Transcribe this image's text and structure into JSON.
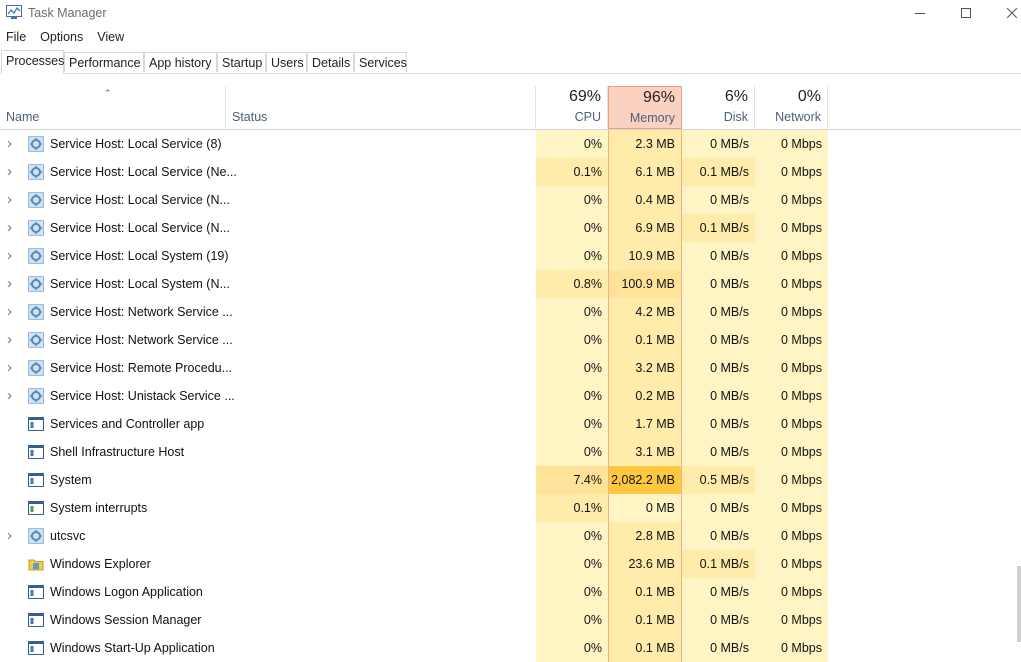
{
  "window": {
    "title": "Task Manager"
  },
  "menu": [
    "File",
    "Options",
    "View"
  ],
  "tabs": [
    "Processes",
    "Performance",
    "App history",
    "Startup",
    "Users",
    "Details",
    "Services"
  ],
  "header": {
    "name": "Name",
    "status": "Status",
    "cpu": {
      "pct": "69%",
      "label": "CPU"
    },
    "memory": {
      "pct": "96%",
      "label": "Memory"
    },
    "disk": {
      "pct": "6%",
      "label": "Disk"
    },
    "network": {
      "pct": "0%",
      "label": "Network"
    }
  },
  "rows": [
    {
      "name": "Service Host: Local Service (8)",
      "cpu": "0%",
      "memory": "2.3 MB",
      "disk": "0 MB/s",
      "network": "0 Mbps",
      "expandable": true,
      "icon": "gear",
      "heat": [
        0,
        1,
        0,
        0
      ]
    },
    {
      "name": "Service Host: Local Service (Ne...",
      "cpu": "0.1%",
      "memory": "6.1 MB",
      "disk": "0.1 MB/s",
      "network": "0 Mbps",
      "expandable": true,
      "icon": "gear",
      "heat": [
        1,
        1,
        1,
        0
      ]
    },
    {
      "name": "Service Host: Local Service (N...",
      "cpu": "0%",
      "memory": "0.4 MB",
      "disk": "0 MB/s",
      "network": "0 Mbps",
      "expandable": true,
      "icon": "gear",
      "heat": [
        0,
        1,
        0,
        0
      ]
    },
    {
      "name": "Service Host: Local Service (N...",
      "cpu": "0%",
      "memory": "6.9 MB",
      "disk": "0.1 MB/s",
      "network": "0 Mbps",
      "expandable": true,
      "icon": "gear",
      "heat": [
        0,
        1,
        1,
        0
      ]
    },
    {
      "name": "Service Host: Local System (19)",
      "cpu": "0%",
      "memory": "10.9 MB",
      "disk": "0 MB/s",
      "network": "0 Mbps",
      "expandable": true,
      "icon": "gear",
      "heat": [
        0,
        1,
        0,
        0
      ]
    },
    {
      "name": "Service Host: Local System (N...",
      "cpu": "0.8%",
      "memory": "100.9 MB",
      "disk": "0 MB/s",
      "network": "0 Mbps",
      "expandable": true,
      "icon": "gear",
      "heat": [
        1,
        2,
        0,
        0
      ]
    },
    {
      "name": "Service Host: Network Service ...",
      "cpu": "0%",
      "memory": "4.2 MB",
      "disk": "0 MB/s",
      "network": "0 Mbps",
      "expandable": true,
      "icon": "gear",
      "heat": [
        0,
        1,
        0,
        0
      ]
    },
    {
      "name": "Service Host: Network Service ...",
      "cpu": "0%",
      "memory": "0.1 MB",
      "disk": "0 MB/s",
      "network": "0 Mbps",
      "expandable": true,
      "icon": "gear",
      "heat": [
        0,
        1,
        0,
        0
      ]
    },
    {
      "name": "Service Host: Remote Procedu...",
      "cpu": "0%",
      "memory": "3.2 MB",
      "disk": "0 MB/s",
      "network": "0 Mbps",
      "expandable": true,
      "icon": "gear",
      "heat": [
        0,
        1,
        0,
        0
      ]
    },
    {
      "name": "Service Host: Unistack Service ...",
      "cpu": "0%",
      "memory": "0.2 MB",
      "disk": "0 MB/s",
      "network": "0 Mbps",
      "expandable": true,
      "icon": "gear",
      "heat": [
        0,
        1,
        0,
        0
      ]
    },
    {
      "name": "Services and Controller app",
      "cpu": "0%",
      "memory": "1.7 MB",
      "disk": "0 MB/s",
      "network": "0 Mbps",
      "expandable": false,
      "icon": "window",
      "heat": [
        0,
        1,
        0,
        0
      ]
    },
    {
      "name": "Shell Infrastructure Host",
      "cpu": "0%",
      "memory": "3.1 MB",
      "disk": "0 MB/s",
      "network": "0 Mbps",
      "expandable": false,
      "icon": "window",
      "heat": [
        0,
        1,
        0,
        0
      ]
    },
    {
      "name": "System",
      "cpu": "7.4%",
      "memory": "2,082.2 MB",
      "disk": "0.5 MB/s",
      "network": "0 Mbps",
      "expandable": false,
      "icon": "window",
      "heat": [
        2,
        3,
        1,
        0
      ]
    },
    {
      "name": "System interrupts",
      "cpu": "0.1%",
      "memory": "0 MB",
      "disk": "0 MB/s",
      "network": "0 Mbps",
      "expandable": false,
      "icon": "window-green",
      "heat": [
        1,
        0,
        0,
        0
      ]
    },
    {
      "name": "utcsvc",
      "cpu": "0%",
      "memory": "2.8 MB",
      "disk": "0 MB/s",
      "network": "0 Mbps",
      "expandable": true,
      "icon": "gear",
      "heat": [
        0,
        1,
        0,
        0
      ]
    },
    {
      "name": "Windows Explorer",
      "cpu": "0%",
      "memory": "23.6 MB",
      "disk": "0.1 MB/s",
      "network": "0 Mbps",
      "expandable": false,
      "icon": "folder",
      "heat": [
        0,
        1,
        1,
        0
      ]
    },
    {
      "name": "Windows Logon Application",
      "cpu": "0%",
      "memory": "0.1 MB",
      "disk": "0 MB/s",
      "network": "0 Mbps",
      "expandable": false,
      "icon": "window",
      "heat": [
        0,
        1,
        0,
        0
      ]
    },
    {
      "name": "Windows Session Manager",
      "cpu": "0%",
      "memory": "0.1 MB",
      "disk": "0 MB/s",
      "network": "0 Mbps",
      "expandable": false,
      "icon": "window",
      "heat": [
        0,
        1,
        0,
        0
      ]
    },
    {
      "name": "Windows Start-Up Application",
      "cpu": "0%",
      "memory": "0.1 MB",
      "disk": "0 MB/s",
      "network": "0 Mbps",
      "expandable": false,
      "icon": "window",
      "heat": [
        0,
        1,
        0,
        0
      ]
    }
  ],
  "colors": {
    "heat0": "#fff4c4",
    "heat1": "#ffecab",
    "heat2": "#ffe398",
    "heat3": "#ffc840",
    "memoryHeader": "#fbd2c2",
    "headerLabel": "#4c607a"
  }
}
